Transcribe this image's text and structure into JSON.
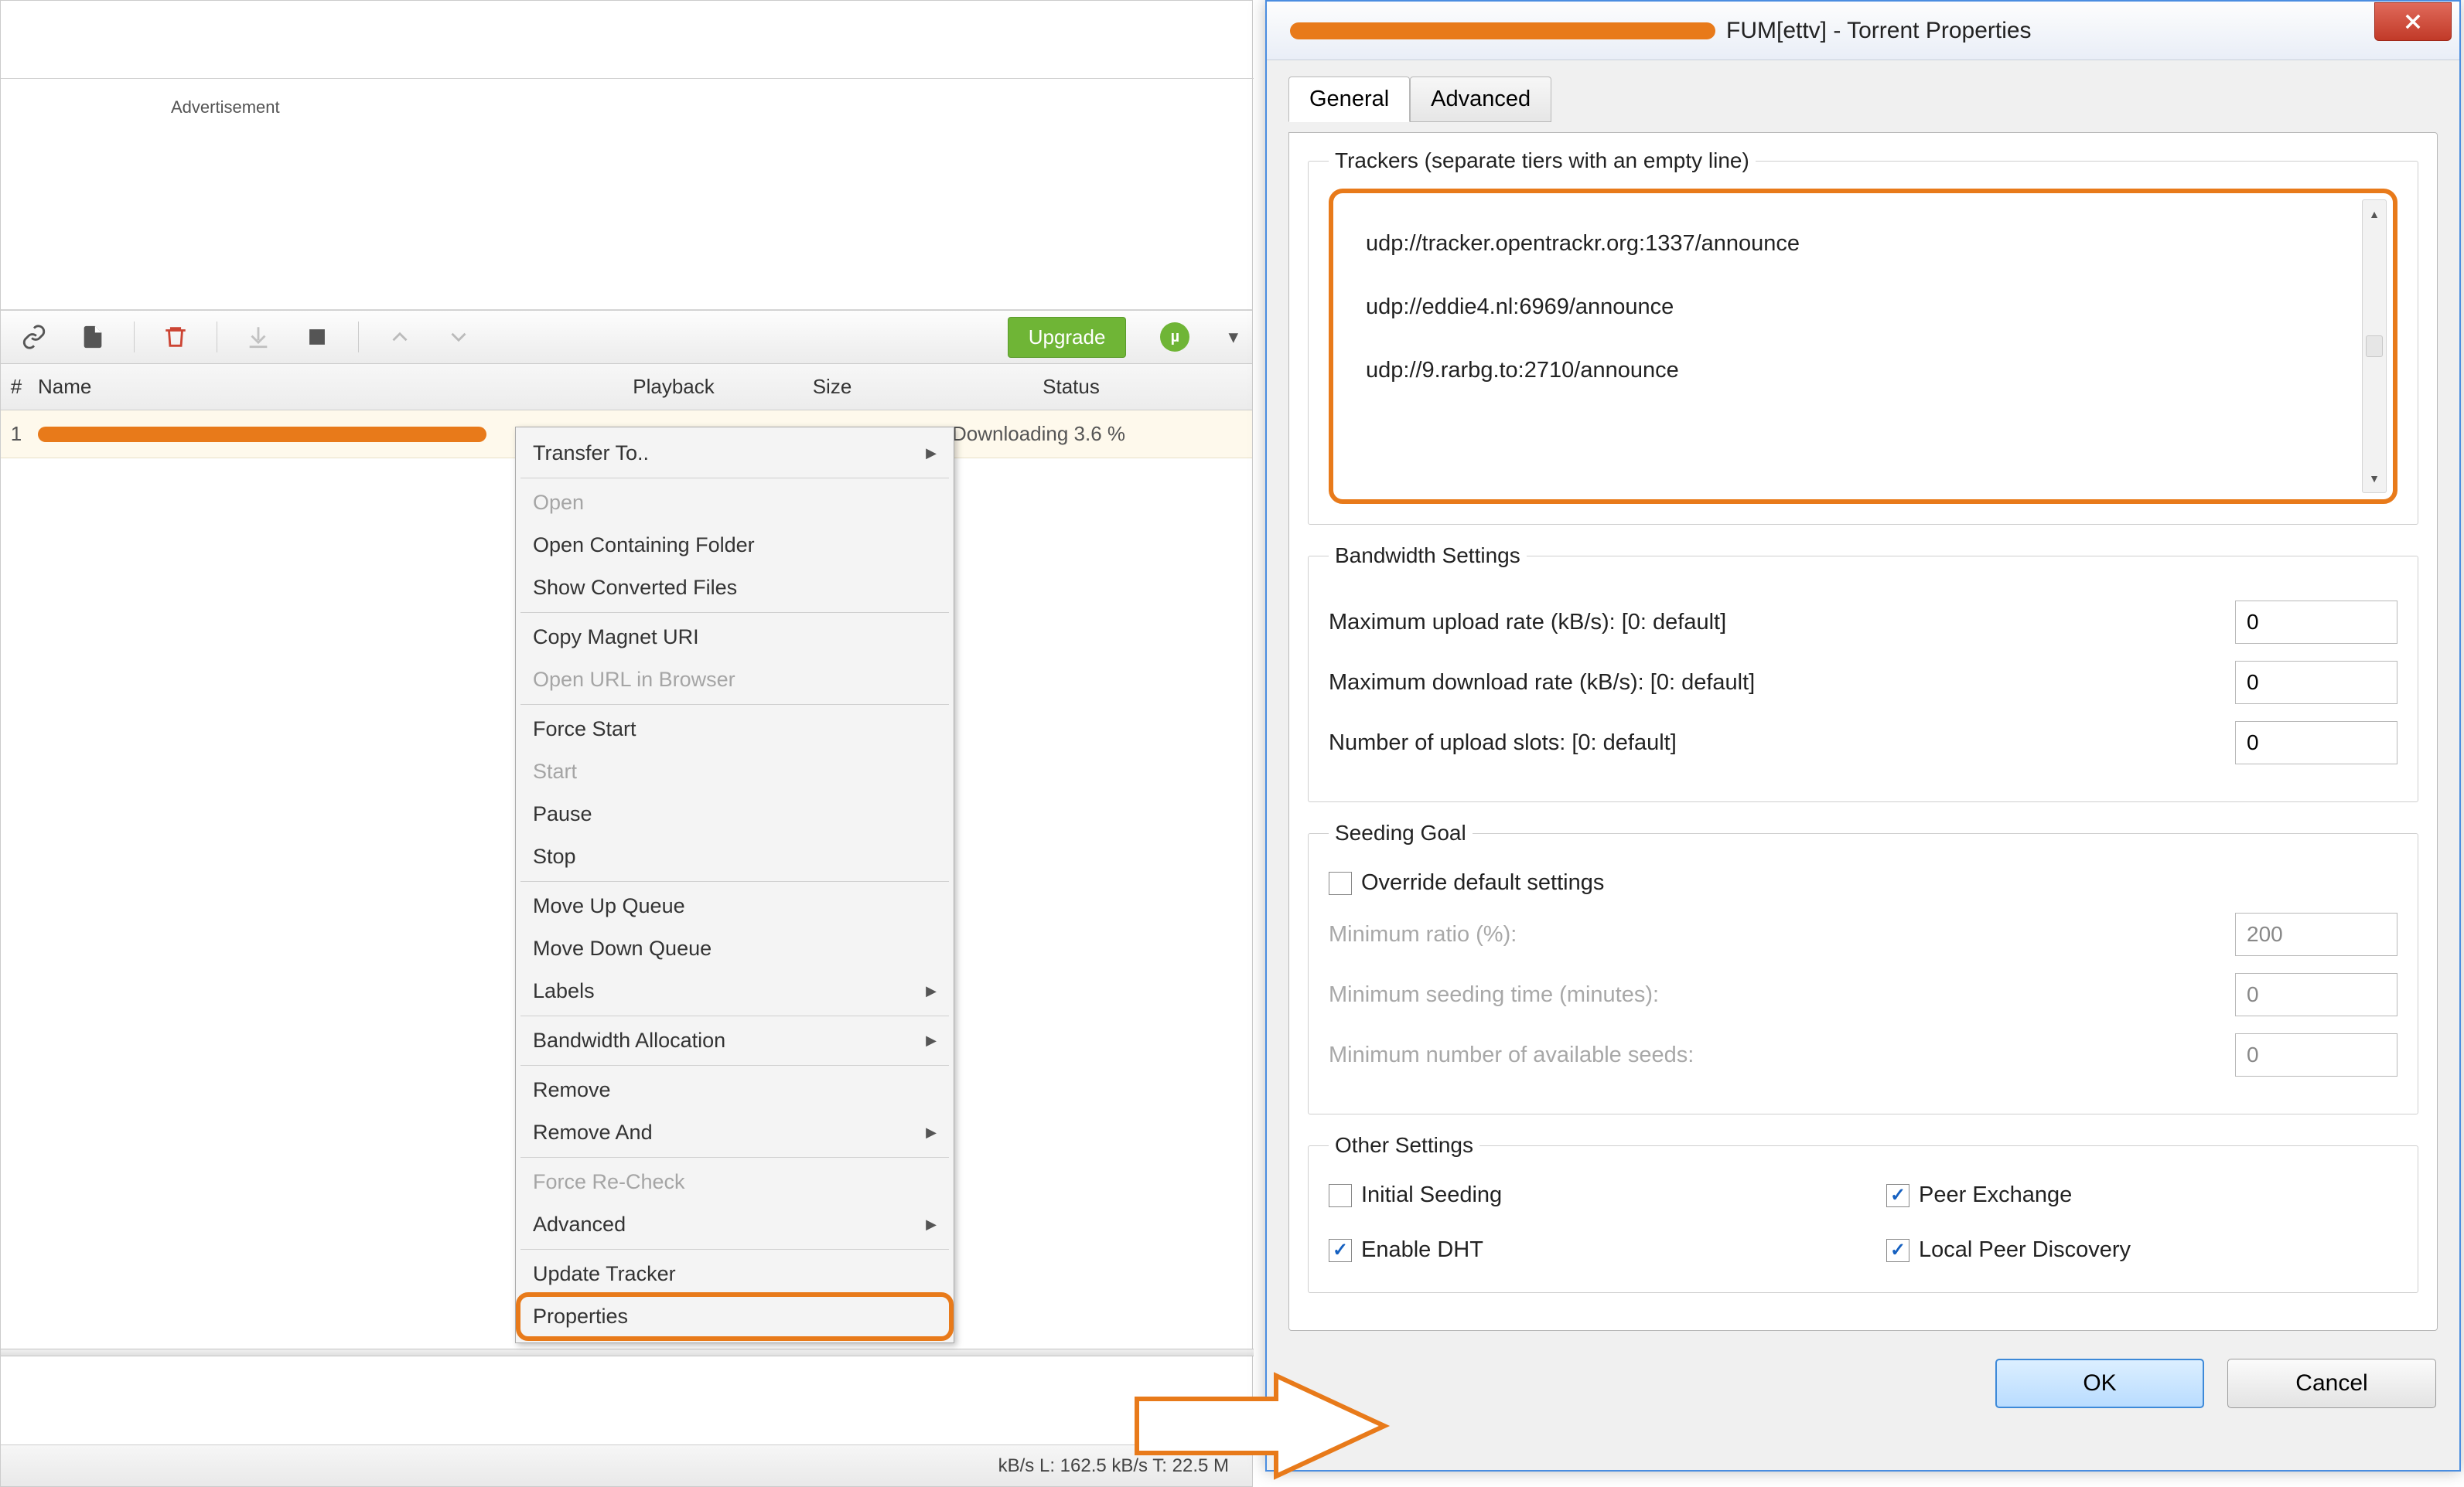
{
  "ad_label": "Advertisement",
  "toolbar": {
    "upgrade": "Upgrade"
  },
  "columns": {
    "num": "#",
    "name": "Name",
    "playback": "Playback",
    "size": "Size",
    "status": "Status"
  },
  "row": {
    "num": "1",
    "status": "Downloading 3.6 %"
  },
  "statusbar": "kB/s L: 162.5 kB/s T: 22.5 M",
  "context_menu": {
    "transfer_to": "Transfer To..",
    "open": "Open",
    "open_containing": "Open Containing Folder",
    "show_converted": "Show Converted Files",
    "copy_magnet": "Copy Magnet URI",
    "open_url": "Open URL in Browser",
    "force_start": "Force Start",
    "start": "Start",
    "pause": "Pause",
    "stop": "Stop",
    "move_up": "Move Up Queue",
    "move_down": "Move Down Queue",
    "labels": "Labels",
    "bandwidth_alloc": "Bandwidth Allocation",
    "remove": "Remove",
    "remove_and": "Remove And",
    "force_recheck": "Force Re-Check",
    "advanced": "Advanced",
    "update_tracker": "Update Tracker",
    "properties": "Properties"
  },
  "dialog": {
    "title_suffix": "FUM[ettv] - Torrent Properties",
    "tabs": {
      "general": "General",
      "advanced": "Advanced"
    },
    "trackers": {
      "legend": "Trackers (separate tiers with an empty line)",
      "t1": "udp://tracker.opentrackr.org:1337/announce",
      "t2": "udp://eddie4.nl:6969/announce",
      "t3": "udp://9.rarbg.to:2710/announce"
    },
    "bandwidth": {
      "legend": "Bandwidth Settings",
      "max_up": "Maximum upload rate (kB/s): [0: default]",
      "max_down": "Maximum download rate (kB/s): [0: default]",
      "upload_slots": "Number of upload slots: [0: default]",
      "v_up": "0",
      "v_down": "0",
      "v_slots": "0"
    },
    "seeding": {
      "legend": "Seeding Goal",
      "override": "Override default settings",
      "min_ratio": "Minimum ratio (%):",
      "min_time": "Minimum seeding time (minutes):",
      "min_seeds": "Minimum number of available seeds:",
      "v_ratio": "200",
      "v_time": "0",
      "v_seeds": "0"
    },
    "other": {
      "legend": "Other Settings",
      "initial_seeding": "Initial Seeding",
      "peer_exchange": "Peer Exchange",
      "enable_dht": "Enable DHT",
      "local_peer": "Local Peer Discovery"
    },
    "buttons": {
      "ok": "OK",
      "cancel": "Cancel"
    }
  }
}
